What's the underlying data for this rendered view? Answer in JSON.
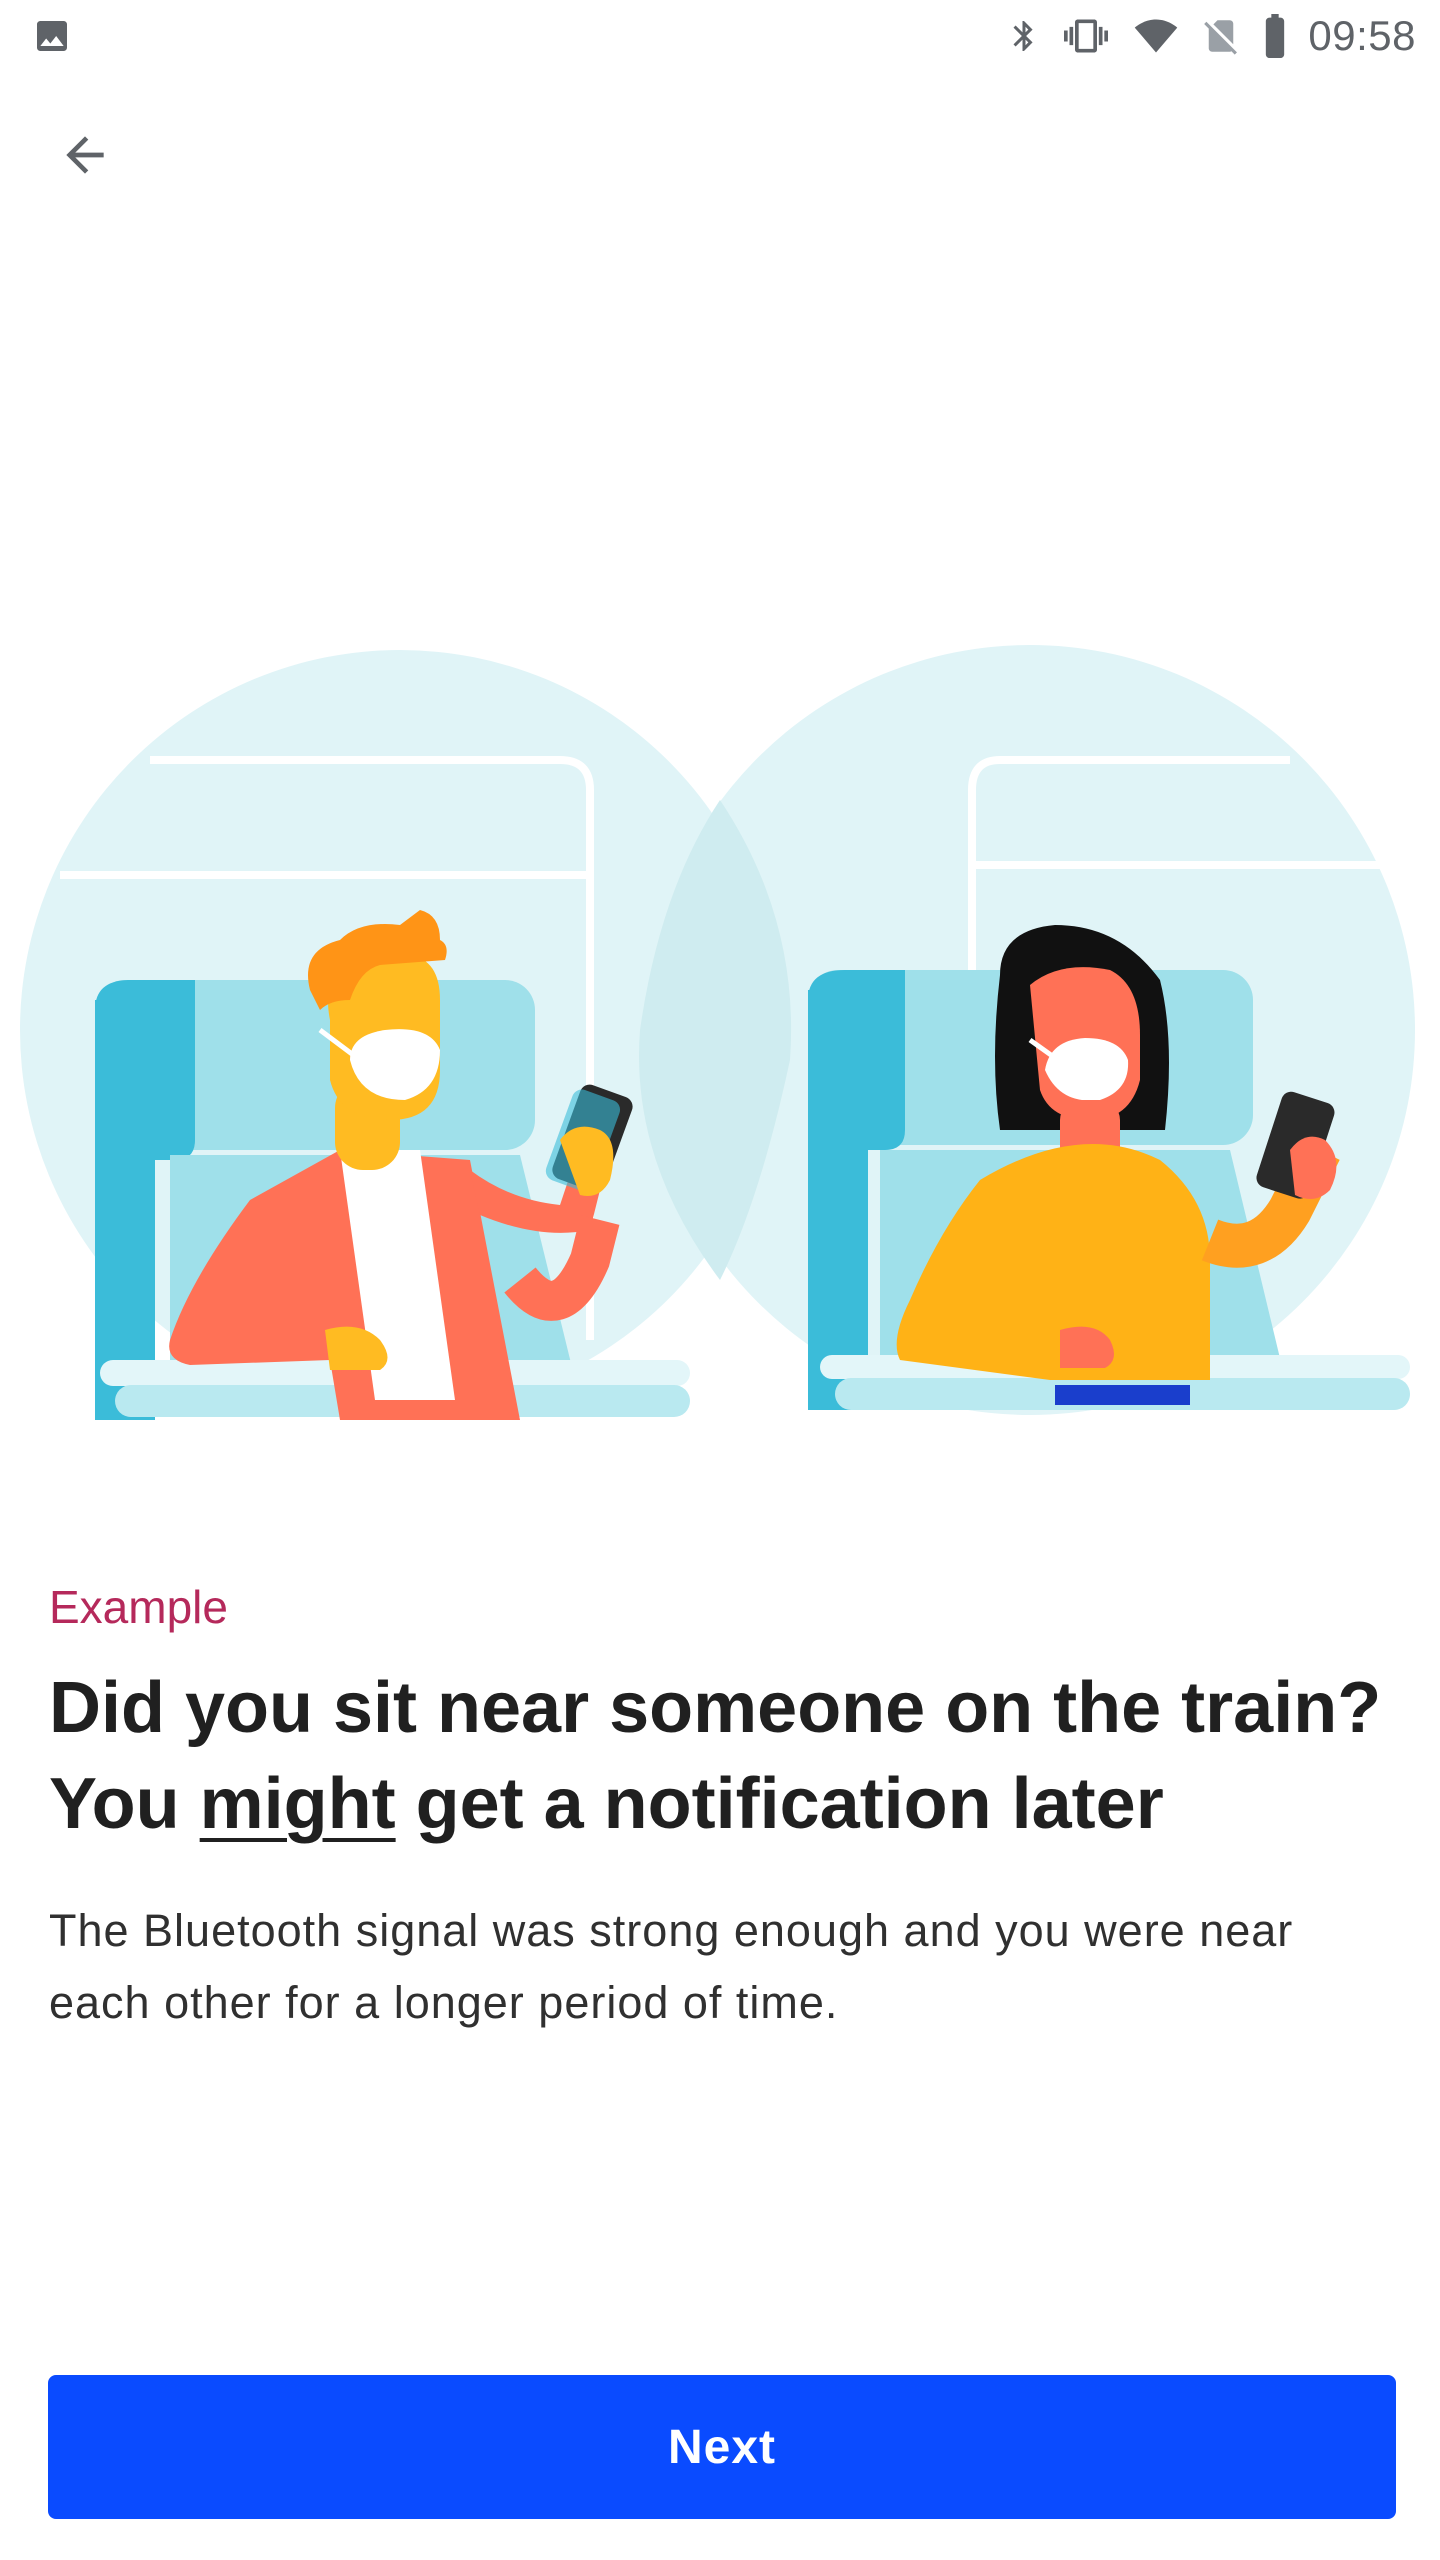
{
  "status_bar": {
    "time": "09:58",
    "icons": [
      "image-icon",
      "bluetooth-icon",
      "vibrate-icon",
      "wifi-icon",
      "no-sim-icon",
      "battery-icon"
    ]
  },
  "navigation": {
    "back_icon": "arrow-left-icon"
  },
  "content": {
    "eyebrow": "Example",
    "headline_line1": "Did you sit near someone on the train?",
    "headline_line2_prefix": "You ",
    "headline_line2_emphasis": "might",
    "headline_line2_suffix": " get a notification later",
    "body": "The Bluetooth signal was strong enough and you were near each other for a longer period of time."
  },
  "actions": {
    "next_label": "Next"
  },
  "colors": {
    "accent": "#0a4bff",
    "eyebrow": "#b5295b",
    "circle": "#e0f4f7",
    "seat_dark": "#3bbcd9",
    "seat_light": "#9fe0ea"
  }
}
